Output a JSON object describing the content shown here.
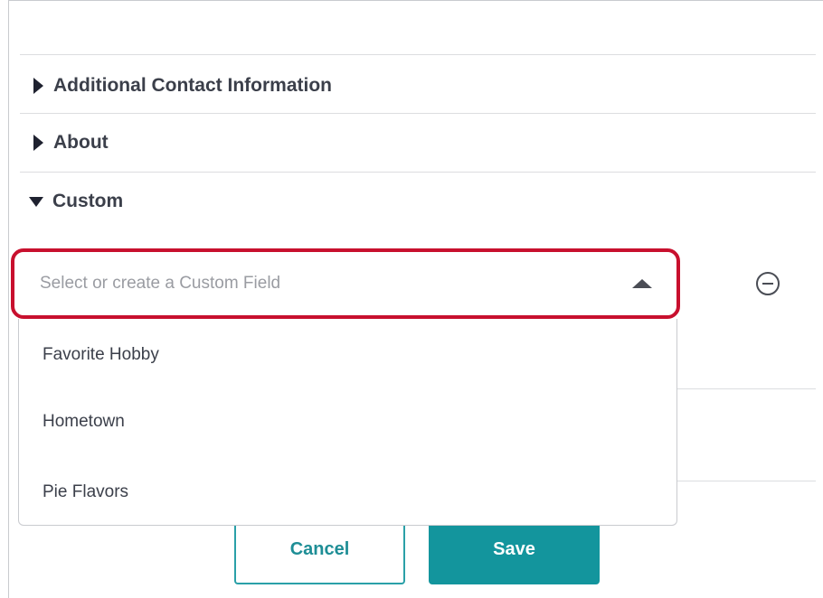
{
  "sections": [
    {
      "label": "Additional Contact Information",
      "expanded": false
    },
    {
      "label": "About",
      "expanded": false
    },
    {
      "label": "Custom",
      "expanded": true
    }
  ],
  "custom_field": {
    "placeholder": "Select or create a Custom Field",
    "options": [
      "Favorite Hobby",
      "Hometown",
      "Pie Flavors"
    ]
  },
  "buttons": {
    "cancel": "Cancel",
    "save": "Save"
  },
  "icons": {
    "collapsed": "caret-right-icon",
    "expanded": "caret-down-icon",
    "dropdown_open": "caret-up-icon",
    "remove": "minus-circle-icon"
  },
  "colors": {
    "highlight": "#c8102e",
    "accent": "#13959d"
  }
}
